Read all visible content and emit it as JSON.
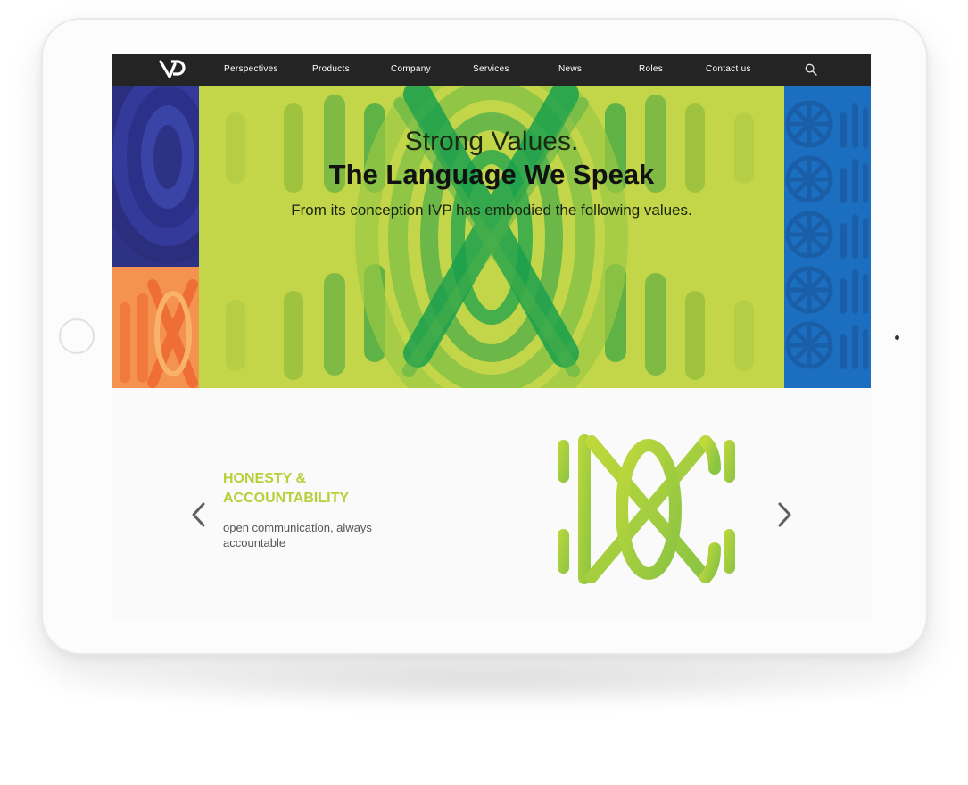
{
  "nav": {
    "items": [
      {
        "label": "Perspectives"
      },
      {
        "label": "Products"
      },
      {
        "label": "Company"
      },
      {
        "label": "Services"
      },
      {
        "label": "News"
      },
      {
        "label": "Roles"
      },
      {
        "label": "Contact us"
      }
    ],
    "logo_icon": "ivp-logo-icon",
    "search_icon": "search-icon"
  },
  "hero": {
    "line1": "Strong Values.",
    "line2": "The Language We Speak",
    "line3": "From its conception IVP has embodied the following values."
  },
  "slider": {
    "title": "HONESTY & ACCOUNTABILITY",
    "description": "open communication, always accountable",
    "prev_icon": "chevron-left-icon",
    "next_icon": "chevron-right-icon",
    "value_icon": "honesty-accountability-icon"
  },
  "colors": {
    "nav_bg": "#242424",
    "hero_green": "#c3d64a",
    "accent_green": "#b8cf3a",
    "left_blue": "#2d3287",
    "left_orange": "#f48b4a",
    "right_blue": "#1c6fc0"
  }
}
